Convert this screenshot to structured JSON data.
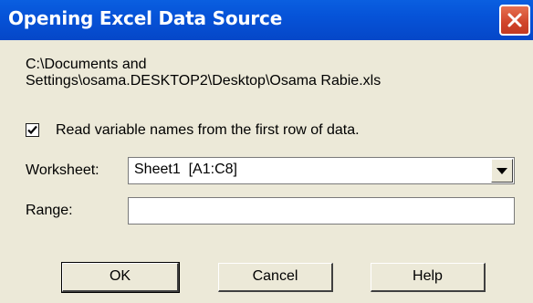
{
  "window": {
    "title": "Opening Excel Data Source",
    "close_icon": "close-icon"
  },
  "file_path": {
    "line1": "C:\\Documents and",
    "line2": "Settings\\osama.DESKTOP2\\Desktop\\Osama Rabie.xls"
  },
  "read_names": {
    "label": "Read variable names from the first row of data.",
    "checked": true
  },
  "worksheet": {
    "label": "Worksheet:",
    "value": "Sheet1  [A1:C8]",
    "icon": "chevron-down-icon"
  },
  "range": {
    "label": "Range:",
    "value": ""
  },
  "buttons": {
    "ok": "OK",
    "cancel": "Cancel",
    "help": "Help"
  }
}
